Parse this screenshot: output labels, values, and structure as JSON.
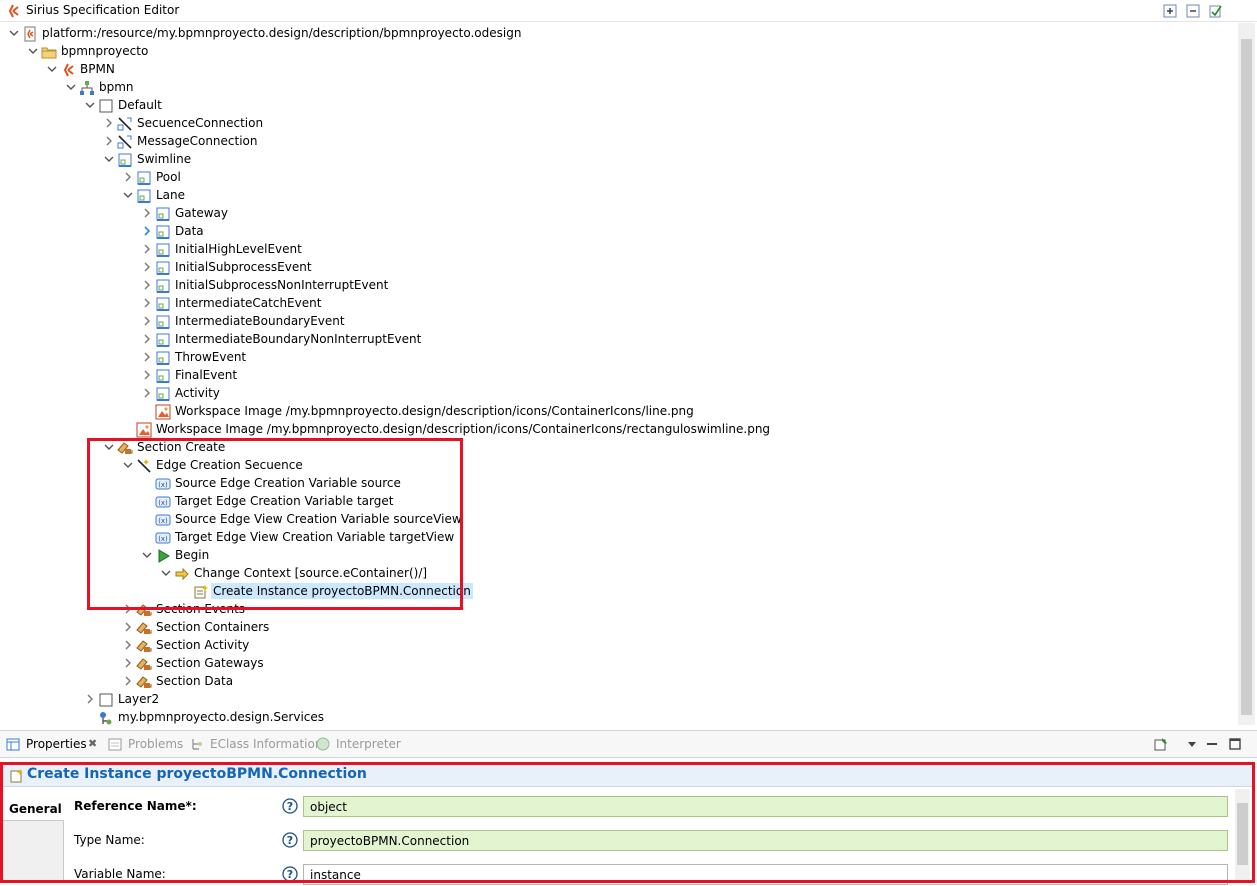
{
  "window": {
    "title": "Sirius Specification Editor"
  },
  "tree": [
    {
      "label": "platform:/resource/my.bpmnproyecto.design/description/bpmnproyecto.odesign",
      "icon": "odesign-file-icon",
      "expand": "open",
      "depth": 0,
      "name": "tree-item-odesign-root"
    },
    {
      "label": "bpmnproyecto",
      "icon": "folder-icon",
      "expand": "open",
      "depth": 1,
      "name": "tree-item-bpmnproyecto"
    },
    {
      "label": "BPMN",
      "icon": "sirius-viewpoint-icon",
      "expand": "open",
      "depth": 2,
      "name": "tree-item-bpmn-viewpoint"
    },
    {
      "label": "bpmn",
      "icon": "diagram-description-icon",
      "expand": "open",
      "depth": 3,
      "name": "tree-item-bpmn-diagram"
    },
    {
      "label": "Default",
      "icon": "layer-icon",
      "expand": "open",
      "depth": 4,
      "name": "tree-item-default-layer"
    },
    {
      "label": "SecuenceConnection",
      "icon": "edge-mapping-icon",
      "expand": "closed",
      "depth": 5,
      "name": "tree-item-secuence-connection"
    },
    {
      "label": "MessageConnection",
      "icon": "edge-mapping-icon",
      "expand": "closed",
      "depth": 5,
      "name": "tree-item-message-connection"
    },
    {
      "label": "Swimline",
      "icon": "container-mapping-icon",
      "expand": "open",
      "depth": 5,
      "name": "tree-item-swimline"
    },
    {
      "label": "Pool",
      "icon": "container-mapping-icon",
      "expand": "closed",
      "depth": 6,
      "name": "tree-item-pool"
    },
    {
      "label": "Lane",
      "icon": "container-mapping-icon",
      "expand": "open",
      "depth": 6,
      "name": "tree-item-lane"
    },
    {
      "label": "Gateway",
      "icon": "container-mapping-icon",
      "expand": "closed",
      "depth": 7,
      "name": "tree-item-gateway"
    },
    {
      "label": "Data",
      "icon": "container-mapping-icon",
      "expand": "closed-hover",
      "depth": 7,
      "name": "tree-item-data"
    },
    {
      "label": "InitialHighLevelEvent",
      "icon": "container-mapping-icon",
      "expand": "closed",
      "depth": 7,
      "name": "tree-item-initial-high-level-event"
    },
    {
      "label": "InitialSubprocessEvent",
      "icon": "container-mapping-icon",
      "expand": "closed",
      "depth": 7,
      "name": "tree-item-initial-subprocess-event"
    },
    {
      "label": "InitialSubprocessNonInterruptEvent",
      "icon": "container-mapping-icon",
      "expand": "closed",
      "depth": 7,
      "name": "tree-item-initial-subprocess-noninterrupt-event"
    },
    {
      "label": "IntermediateCatchEvent",
      "icon": "container-mapping-icon",
      "expand": "closed",
      "depth": 7,
      "name": "tree-item-intermediate-catch-event"
    },
    {
      "label": "IntermediateBoundaryEvent",
      "icon": "container-mapping-icon",
      "expand": "closed",
      "depth": 7,
      "name": "tree-item-intermediate-boundary-event"
    },
    {
      "label": "IntermediateBoundaryNonInterruptEvent",
      "icon": "container-mapping-icon",
      "expand": "closed",
      "depth": 7,
      "name": "tree-item-intermediate-boundary-noninterrupt-event"
    },
    {
      "label": "ThrowEvent",
      "icon": "container-mapping-icon",
      "expand": "closed",
      "depth": 7,
      "name": "tree-item-throw-event"
    },
    {
      "label": "FinalEvent",
      "icon": "container-mapping-icon",
      "expand": "closed",
      "depth": 7,
      "name": "tree-item-final-event"
    },
    {
      "label": "Activity",
      "icon": "container-mapping-icon",
      "expand": "closed",
      "depth": 7,
      "name": "tree-item-activity"
    },
    {
      "label": "Workspace Image /my.bpmnproyecto.design/description/icons/ContainerIcons/line.png",
      "icon": "workspace-image-icon",
      "expand": "none",
      "depth": 7,
      "name": "tree-item-workspace-image-line"
    },
    {
      "label": "Workspace Image /my.bpmnproyecto.design/description/icons/ContainerIcons/rectanguloswimline.png",
      "icon": "workspace-image-icon",
      "expand": "none",
      "depth": 6,
      "name": "tree-item-workspace-image-rectangulo"
    },
    {
      "label": "Section Create",
      "icon": "tool-section-icon",
      "expand": "open",
      "depth": 5,
      "name": "tree-item-section-create"
    },
    {
      "label": "Edge Creation Secuence",
      "icon": "edge-creation-icon",
      "expand": "open",
      "depth": 6,
      "name": "tree-item-edge-creation-secuence"
    },
    {
      "label": "Source Edge Creation Variable source",
      "icon": "variable-icon",
      "expand": "none",
      "depth": 7,
      "name": "tree-item-source-edge-creation-variable"
    },
    {
      "label": "Target Edge Creation Variable target",
      "icon": "variable-icon",
      "expand": "none",
      "depth": 7,
      "name": "tree-item-target-edge-creation-variable"
    },
    {
      "label": "Source Edge View Creation Variable sourceView",
      "icon": "variable-icon",
      "expand": "none",
      "depth": 7,
      "name": "tree-item-source-edge-view-variable"
    },
    {
      "label": "Target Edge View Creation Variable targetView",
      "icon": "variable-icon",
      "expand": "none",
      "depth": 7,
      "name": "tree-item-target-edge-view-variable"
    },
    {
      "label": "Begin",
      "icon": "begin-icon",
      "expand": "open",
      "depth": 7,
      "name": "tree-item-begin"
    },
    {
      "label": "Change Context [source.eContainer()/]",
      "icon": "change-context-icon",
      "expand": "open",
      "depth": 8,
      "name": "tree-item-change-context"
    },
    {
      "label": "Create Instance proyectoBPMN.Connection",
      "icon": "create-instance-icon",
      "expand": "none",
      "depth": 9,
      "name": "tree-item-create-instance",
      "selected": true
    },
    {
      "label": "Section Events",
      "icon": "tool-section-icon",
      "expand": "closed",
      "depth": 6,
      "name": "tree-item-section-events"
    },
    {
      "label": "Section Containers",
      "icon": "tool-section-icon",
      "expand": "closed",
      "depth": 6,
      "name": "tree-item-section-containers"
    },
    {
      "label": "Section Activity",
      "icon": "tool-section-icon",
      "expand": "closed",
      "depth": 6,
      "name": "tree-item-section-activity"
    },
    {
      "label": "Section Gateways",
      "icon": "tool-section-icon",
      "expand": "closed",
      "depth": 6,
      "name": "tree-item-section-gateways"
    },
    {
      "label": "Section Data",
      "icon": "tool-section-icon",
      "expand": "closed",
      "depth": 6,
      "name": "tree-item-section-data"
    },
    {
      "label": "Layer2",
      "icon": "layer-icon",
      "expand": "closed",
      "depth": 4,
      "name": "tree-item-layer2"
    },
    {
      "label": "my.bpmnproyecto.design.Services",
      "icon": "java-extension-icon",
      "expand": "none",
      "depth": 4,
      "name": "tree-item-services"
    }
  ],
  "views": {
    "tabs": [
      {
        "label": "Properties",
        "active": true,
        "icon": "properties-icon",
        "name": "tab-properties"
      },
      {
        "label": "Problems",
        "active": false,
        "icon": "problems-icon",
        "name": "tab-problems"
      },
      {
        "label": "EClass Information",
        "active": false,
        "icon": "eclass-info-icon",
        "name": "tab-eclass-information"
      },
      {
        "label": "Interpreter",
        "active": false,
        "icon": "interpreter-icon",
        "name": "tab-interpreter"
      }
    ]
  },
  "properties": {
    "header": "Create Instance proyectoBPMN.Connection",
    "section_tab": "General",
    "fields": [
      {
        "label": "Reference Name*:",
        "value": "object",
        "required": true,
        "name": "reference-name-field"
      },
      {
        "label": "Type Name:",
        "value": "proyectoBPMN.Connection",
        "required": false,
        "name": "type-name-field"
      },
      {
        "label": "Variable Name:",
        "value": "instance",
        "required": false,
        "name": "variable-name-field"
      }
    ]
  },
  "colors": {
    "accent": "#1564b6",
    "highlight": "#e81123",
    "field_bg": "#e3f5d0",
    "selection": "#cce8ff"
  }
}
